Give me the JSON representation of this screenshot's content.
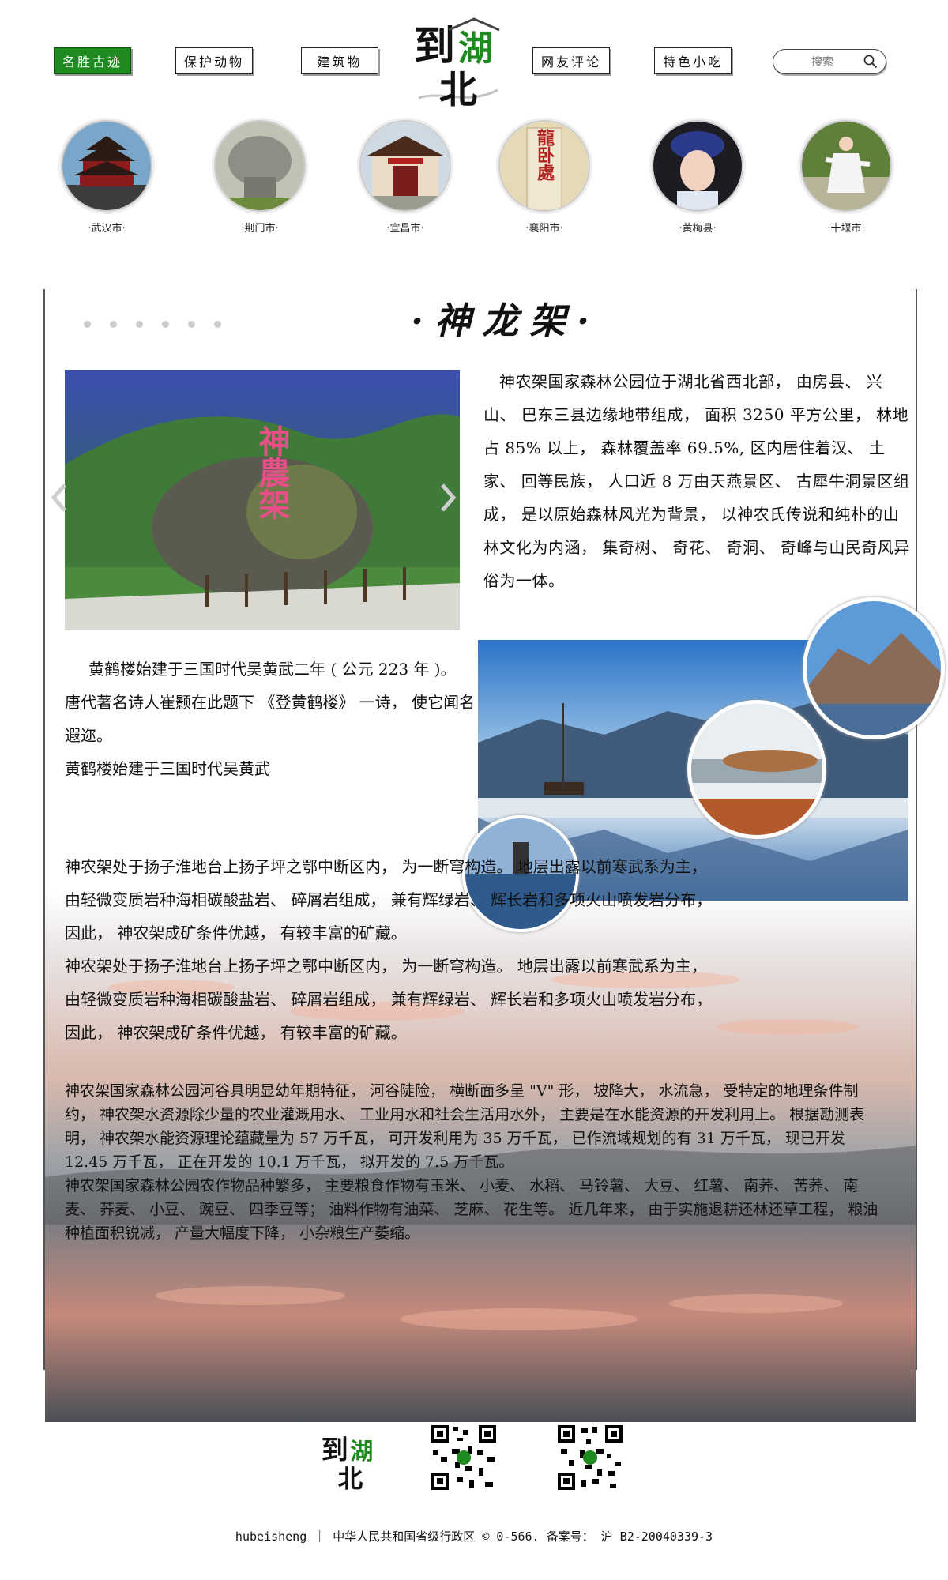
{
  "nav": {
    "items": [
      "名胜古迹",
      "保护动物",
      "建筑物",
      "网友评论",
      "特色小吃"
    ],
    "active_index": 0,
    "search_placeholder": "搜索"
  },
  "logo": {
    "text": "到湖北"
  },
  "cities": [
    "·武汉市·",
    "·荆门市·",
    "·宜昌市·",
    "·襄阳市·",
    "·黄梅县·",
    "·十堰市·"
  ],
  "city_images": {
    "yichang_gate": "龍卧處"
  },
  "section": {
    "title": "·神龙架·",
    "rock_inscription": "神農架",
    "intro": "神农架国家森林公园位于湖北省西北部， 由房县、 兴山、 巴东三县边缘地带组成， 面积 3250 平方公里， 林地占 85% 以上， 森林覆盖率 69.5%, 区内居住着汉、 土家、 回等民族， 人口近 8 万由天燕景区、 古犀牛洞景区组成， 是以原始森林风光为背景， 以神农氏传说和纯朴的山林文化为内涵， 集奇树、 奇花、 奇洞、 奇峰与山民奇风异俗为一体。",
    "yellow_crane_1": "黄鹤楼始建于三国时代吴黄武二年 ( 公元 223 年 )。 唐代著名诗人崔颢在此题下 《登黄鹤楼》 一诗， 使它闻名遐迩。",
    "yellow_crane_2": "黄鹤楼始建于三国时代吴黄武",
    "geology_1a": "神农架处于扬子淮地台上扬子坪之鄂中断区内， 为一断穹构造。 地层出露以前寒武系为主，",
    "geology_1b": "由轻微变质岩种海相碳酸盐岩、 碎屑岩组成， 兼有辉绿岩、 辉长岩和多项火山喷发岩分布，",
    "geology_1c": "因此， 神农架成矿条件优越， 有较丰富的矿藏。",
    "geology_2a": "神农架处于扬子淮地台上扬子坪之鄂中断区内， 为一断穹构造。 地层出露以前寒武系为主，",
    "geology_2b": "由轻微变质岩种海相碳酸盐岩、 碎屑岩组成， 兼有辉绿岩、 辉长岩和多项火山喷发岩分布，",
    "geology_2c": "因此， 神农架成矿条件优越， 有较丰富的矿藏。",
    "water": "神农架国家森林公园河谷具明显幼年期特征， 河谷陡险， 横断面多呈 \"V\" 形， 坡降大， 水流急， 受特定的地理条件制约， 神农架水资源除少量的农业灌溉用水、 工业用水和社会生活用水外， 主要是在水能资源的开发利用上。 根据勘测表明， 神农架水能资源理论蕴藏量为 57 万千瓦， 可开发利用为 35 万千瓦， 已作流域规划的有 31 万千瓦， 现已开发 12.45 万千瓦， 正在开发的 10.1 万千瓦， 拟开发的 7.5 万千瓦。",
    "crops": "神农架国家森林公园农作物品种繁多， 主要粮食作物有玉米、 小麦、 水稻、 马铃薯、 大豆、 红薯、 南荞、 苦荞、 南麦、 荞麦、 小豆、 豌豆、 四季豆等； 油料作物有油菜、 芝麻、 花生等。 近几年来， 由于实施退耕还林还草工程， 粮油种植面积锐减， 产量大幅度下降， 小杂粮生产萎缩。"
  },
  "footer": {
    "text": "hubeisheng ｜ 中华人民共和国省级行政区 © 0-566. 备案号： 沪 B2-20040339-3"
  },
  "colors": {
    "accent_green": "#1f8a1f",
    "border": "#555555"
  }
}
